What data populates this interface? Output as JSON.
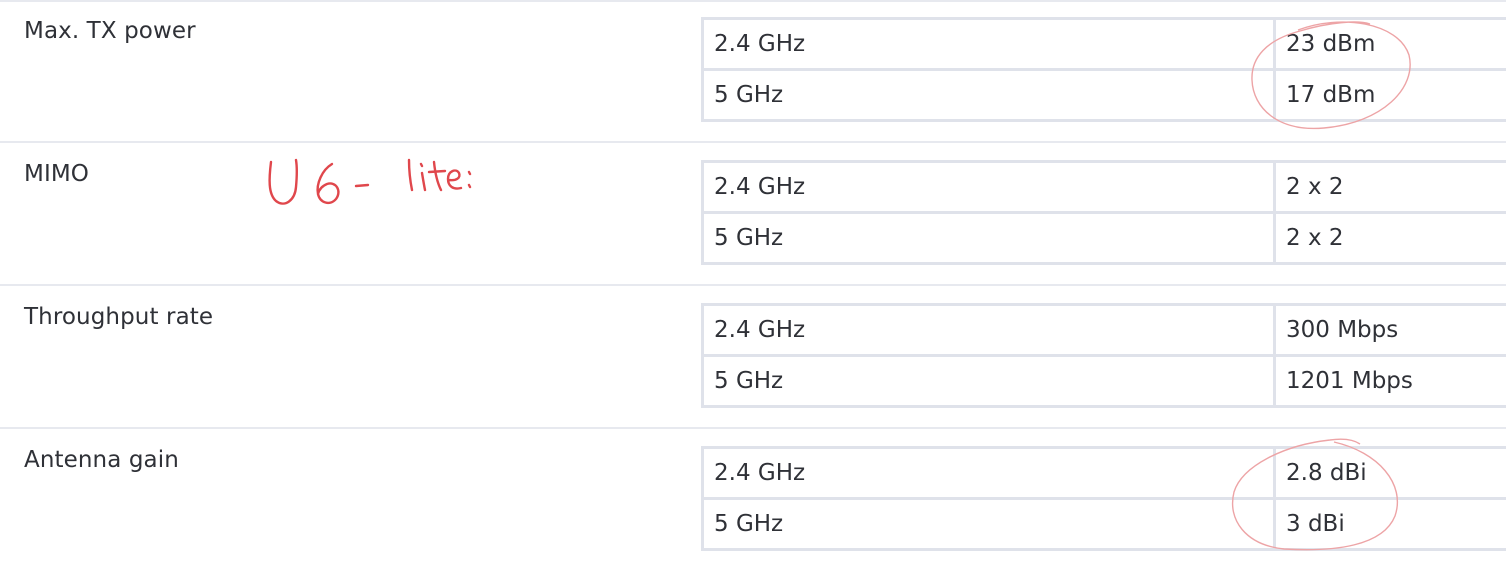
{
  "specs": [
    {
      "label": "Max. TX power",
      "rows": [
        {
          "band": "2.4 GHz",
          "value": "23 dBm"
        },
        {
          "band": "5 GHz",
          "value": "17 dBm"
        }
      ]
    },
    {
      "label": "MIMO",
      "rows": [
        {
          "band": "2.4 GHz",
          "value": "2 x 2"
        },
        {
          "band": "5 GHz",
          "value": "2 x 2"
        }
      ]
    },
    {
      "label": "Throughput rate",
      "rows": [
        {
          "band": "2.4 GHz",
          "value": "300 Mbps"
        },
        {
          "band": "5 GHz",
          "value": "1201 Mbps"
        }
      ]
    },
    {
      "label": "Antenna gain",
      "rows": [
        {
          "band": "2.4 GHz",
          "value": "2.8 dBi"
        },
        {
          "band": "5 GHz",
          "value": "3 dBi"
        }
      ]
    }
  ],
  "annotations": {
    "handwritten_note": "U6 - lite:",
    "ink_color": "#e0474c",
    "circle_color": "#eda4a6"
  }
}
